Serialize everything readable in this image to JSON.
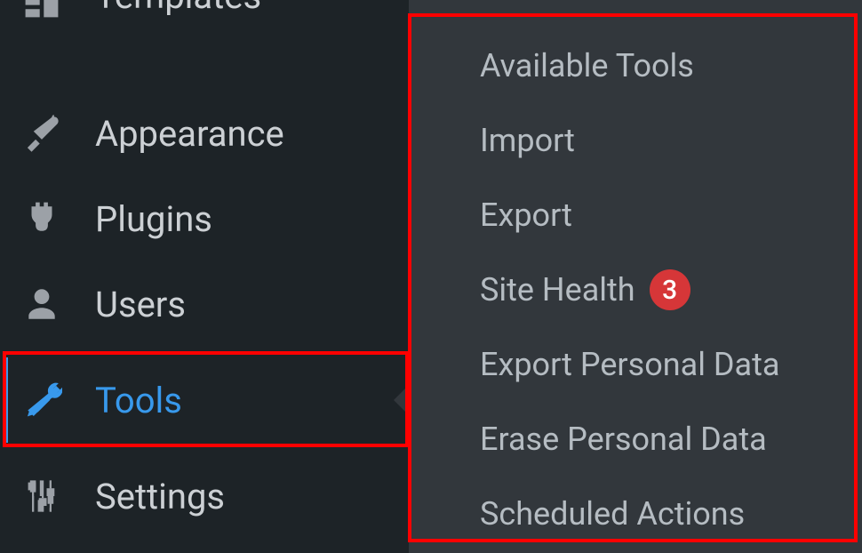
{
  "sidebar": {
    "items": [
      {
        "label": "Templates",
        "icon": "templates"
      },
      {
        "label": "Appearance",
        "icon": "appearance"
      },
      {
        "label": "Plugins",
        "icon": "plugins"
      },
      {
        "label": "Users",
        "icon": "users"
      },
      {
        "label": "Tools",
        "icon": "tools"
      },
      {
        "label": "Settings",
        "icon": "settings"
      }
    ]
  },
  "submenu": {
    "items": [
      {
        "label": "Available Tools"
      },
      {
        "label": "Import"
      },
      {
        "label": "Export"
      },
      {
        "label": "Site Health",
        "badge": "3"
      },
      {
        "label": "Export Personal Data"
      },
      {
        "label": "Erase Personal Data"
      },
      {
        "label": "Scheduled Actions"
      }
    ]
  }
}
